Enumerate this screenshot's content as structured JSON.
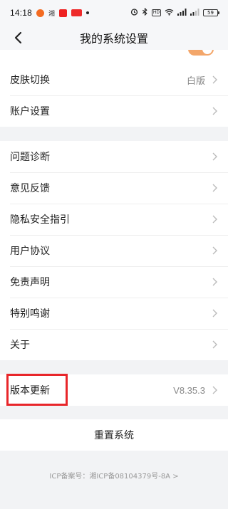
{
  "status_bar": {
    "time": "14:18",
    "left_icons": [
      "weibo-icon",
      "xiang-icon",
      "app-icon",
      "red-badge-icon",
      "dot-icon"
    ],
    "xiang_text": "湘",
    "battery": "59"
  },
  "header": {
    "title": "我的系统设置"
  },
  "group1": [
    {
      "label": "皮肤切换",
      "value": "白版"
    },
    {
      "label": "账户设置",
      "value": ""
    }
  ],
  "group2": [
    {
      "label": "问题诊断"
    },
    {
      "label": "意见反馈"
    },
    {
      "label": "隐私安全指引"
    },
    {
      "label": "用户协议"
    },
    {
      "label": "免责声明"
    },
    {
      "label": "特别鸣谢"
    },
    {
      "label": "关于"
    }
  ],
  "group3": [
    {
      "label": "版本更新",
      "value": "V8.35.3"
    }
  ],
  "reset_label": "重置系统",
  "icp_text": "ICP备案号：湘ICP备08104379号-8A >",
  "colors": {
    "background": "#f2f3f5",
    "highlight": "#e8262a",
    "toggle": "#f3a66a"
  }
}
